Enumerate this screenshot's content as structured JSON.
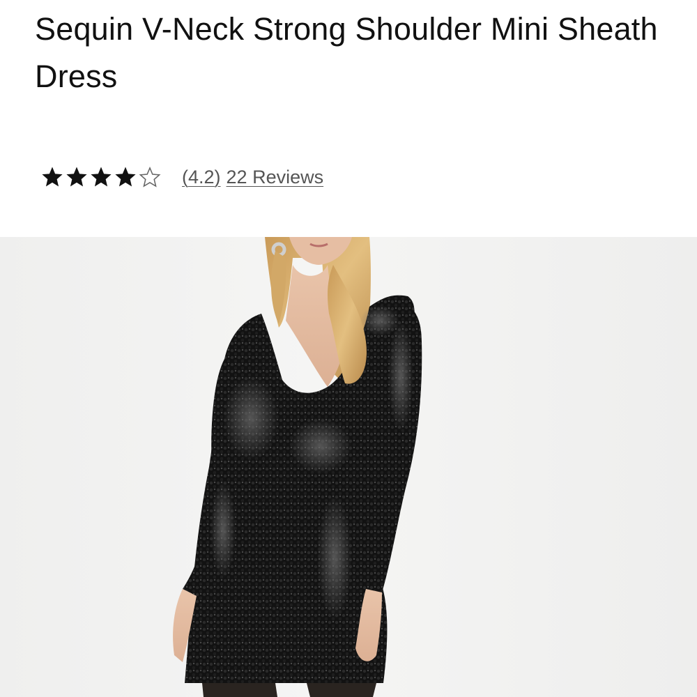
{
  "product": {
    "title": "Sequin V-Neck Strong Shoulder Mini Sheath Dress",
    "rating": {
      "value": 4.2,
      "max": 5,
      "filled_stars": 4,
      "display_value": "(4.2)",
      "reviews_label": "22 Reviews"
    },
    "image": {
      "icon": "product-photo",
      "description_colors": {
        "background": "#f3f3f2",
        "dress": "#141414",
        "skin": "#e8c2a8",
        "hair": "#d8b070"
      }
    }
  },
  "colors": {
    "text": "#111111",
    "link": "#555555",
    "star_filled": "#111111",
    "star_empty": "#666666"
  }
}
